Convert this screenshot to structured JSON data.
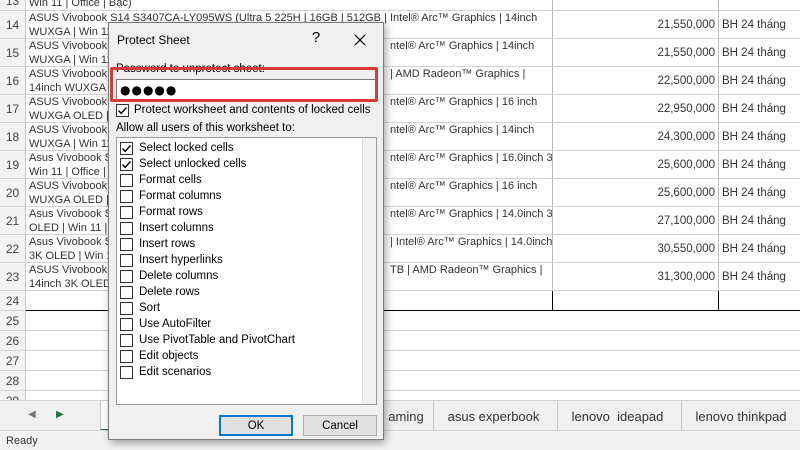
{
  "sheet": {
    "rows": [
      {
        "num": "13",
        "desc1": "Win 11 | Office | Bạc)",
        "desc2": "",
        "price": "",
        "warranty": ""
      },
      {
        "num": "14",
        "desc1": "ASUS Vivobook S14 S3407CA-LY095WS (Ultra 5 225H | 16GB | 512GB | Intel® Arc™ Graphics | 14inch",
        "desc2": "WUXGA | Win 11",
        "price": "21,550,000",
        "warranty": "BH 24 tháng"
      },
      {
        "num": "15",
        "desc1": "ASUS Vivobook S",
        "desc1b": "ntel® Arc™ Graphics | 14inch",
        "desc2": "WUXGA | Win 11",
        "price": "21,550,000",
        "warranty": "BH 24 tháng"
      },
      {
        "num": "16",
        "desc1": "ASUS Vivobook S",
        "desc1b": "| AMD Radeon™ Graphics |",
        "desc2": "14inch WUXGA",
        "price": "22,500,000",
        "warranty": "BH 24 tháng"
      },
      {
        "num": "17",
        "desc1": "ASUS Vivobook S",
        "desc1b": "ntel® Arc™ Graphics | 16 inch",
        "desc2": "WUXGA OLED |",
        "price": "22,950,000",
        "warranty": "BH 24 tháng"
      },
      {
        "num": "18",
        "desc1": "ASUS Vivobook S",
        "desc1b": "ntel® Arc™ Graphics | 14inch",
        "desc2": "WUXGA | Win 11",
        "price": "24,300,000",
        "warranty": "BH 24 tháng"
      },
      {
        "num": "19",
        "desc1": "Asus Vivobook S",
        "desc1b": "ntel® Arc™ Graphics | 16.0inch 3K |",
        "desc2": "Win 11 | Office |",
        "price": "25,600,000",
        "warranty": "BH 24 tháng"
      },
      {
        "num": "20",
        "desc1": "ASUS Vivobook S",
        "desc1b": "ntel® Arc™ Graphics | 16 inch",
        "desc2": "WUXGA OLED |",
        "price": "25,600,000",
        "warranty": "BH 24 tháng"
      },
      {
        "num": "21",
        "desc1": "Asus Vivobook S",
        "desc1b": "ntel® Arc™ Graphics | 14.0inch 3K",
        "desc2": "OLED | Win 11 |",
        "price": "27,100,000",
        "warranty": "BH 24 tháng"
      },
      {
        "num": "22",
        "desc1": "Asus Vivobook S",
        "desc1b": "| Intel® Arc™ Graphics | 14.0inch",
        "desc2": "3K OLED | Win 1",
        "price": "30,550,000",
        "warranty": "BH 24 tháng"
      },
      {
        "num": "23",
        "desc1": "ASUS Vivobook S",
        "desc1b": "TB | AMD Radeon™ Graphics |",
        "desc2": "14inch 3K OLED",
        "price": "31,300,000",
        "warranty": "BH 24 tháng"
      }
    ],
    "empty_rows": [
      "24",
      "25",
      "26",
      "27",
      "28",
      "29"
    ]
  },
  "tabs": {
    "items": [
      {
        "label": "",
        "active": true
      },
      {
        "label": "aming",
        "active": false
      },
      {
        "label": "asus experbook",
        "active": false
      },
      {
        "label": "lenovo  ideapad",
        "active": false
      },
      {
        "label": "lenovo thinkpad",
        "active": false
      }
    ],
    "nav_prev": "◀",
    "nav_next": "▶"
  },
  "status": {
    "text": "Ready"
  },
  "dialog": {
    "title": "Protect Sheet",
    "help": "?",
    "password_label": "Password to unprotect sheet:",
    "password_value": "●●●●●",
    "protect_label": "Protect worksheet and contents of locked cells",
    "protect_checked": true,
    "allow_label": "Allow all users of this worksheet to:",
    "permissions": [
      {
        "label": "Select locked cells",
        "checked": true
      },
      {
        "label": "Select unlocked cells",
        "checked": true
      },
      {
        "label": "Format cells",
        "checked": false
      },
      {
        "label": "Format columns",
        "checked": false
      },
      {
        "label": "Format rows",
        "checked": false
      },
      {
        "label": "Insert columns",
        "checked": false
      },
      {
        "label": "Insert rows",
        "checked": false
      },
      {
        "label": "Insert hyperlinks",
        "checked": false
      },
      {
        "label": "Delete columns",
        "checked": false
      },
      {
        "label": "Delete rows",
        "checked": false
      },
      {
        "label": "Sort",
        "checked": false
      },
      {
        "label": "Use AutoFilter",
        "checked": false
      },
      {
        "label": "Use PivotTable and PivotChart",
        "checked": false
      },
      {
        "label": "Edit objects",
        "checked": false
      },
      {
        "label": "Edit scenarios",
        "checked": false
      }
    ],
    "ok_label": "OK",
    "cancel_label": "Cancel"
  },
  "colors": {
    "highlight": "#d83a3a",
    "ok_border": "#0078d7",
    "active_tab": "#217346"
  }
}
